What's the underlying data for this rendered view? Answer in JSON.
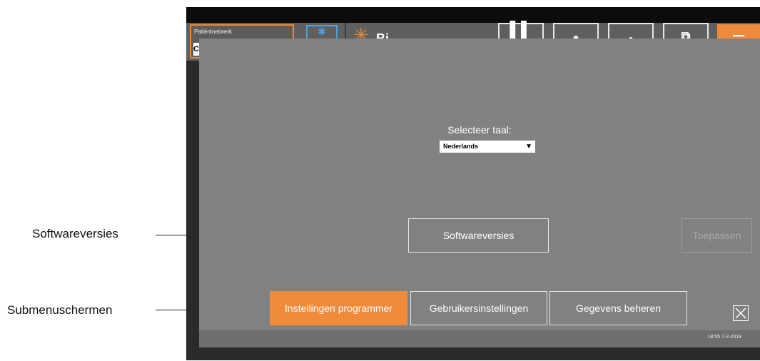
{
  "callouts": {
    "softwareversies": "Softwareversies",
    "submenuschermen": "Submenuschermen"
  },
  "topbar": {
    "patient_network_label": "Patiëntnetwerk",
    "patient_field_value": "C",
    "bluetooth_icon": "bluetooth-icon",
    "logo_text": "Bi",
    "accent_color": "#ef8a3c"
  },
  "settings": {
    "language_label": "Selecteer taal:",
    "language_value": "Nederlands",
    "softwareversies_button": "Softwareversies",
    "apply_button": "Toepassen",
    "tabs": [
      {
        "label": "Instellingen programmer",
        "active": true
      },
      {
        "label": "Gebruikersinstellingen",
        "active": false
      },
      {
        "label": "Gegevens beheren",
        "active": false
      }
    ]
  },
  "status": {
    "datetime": "18:55 7-2-2019"
  }
}
